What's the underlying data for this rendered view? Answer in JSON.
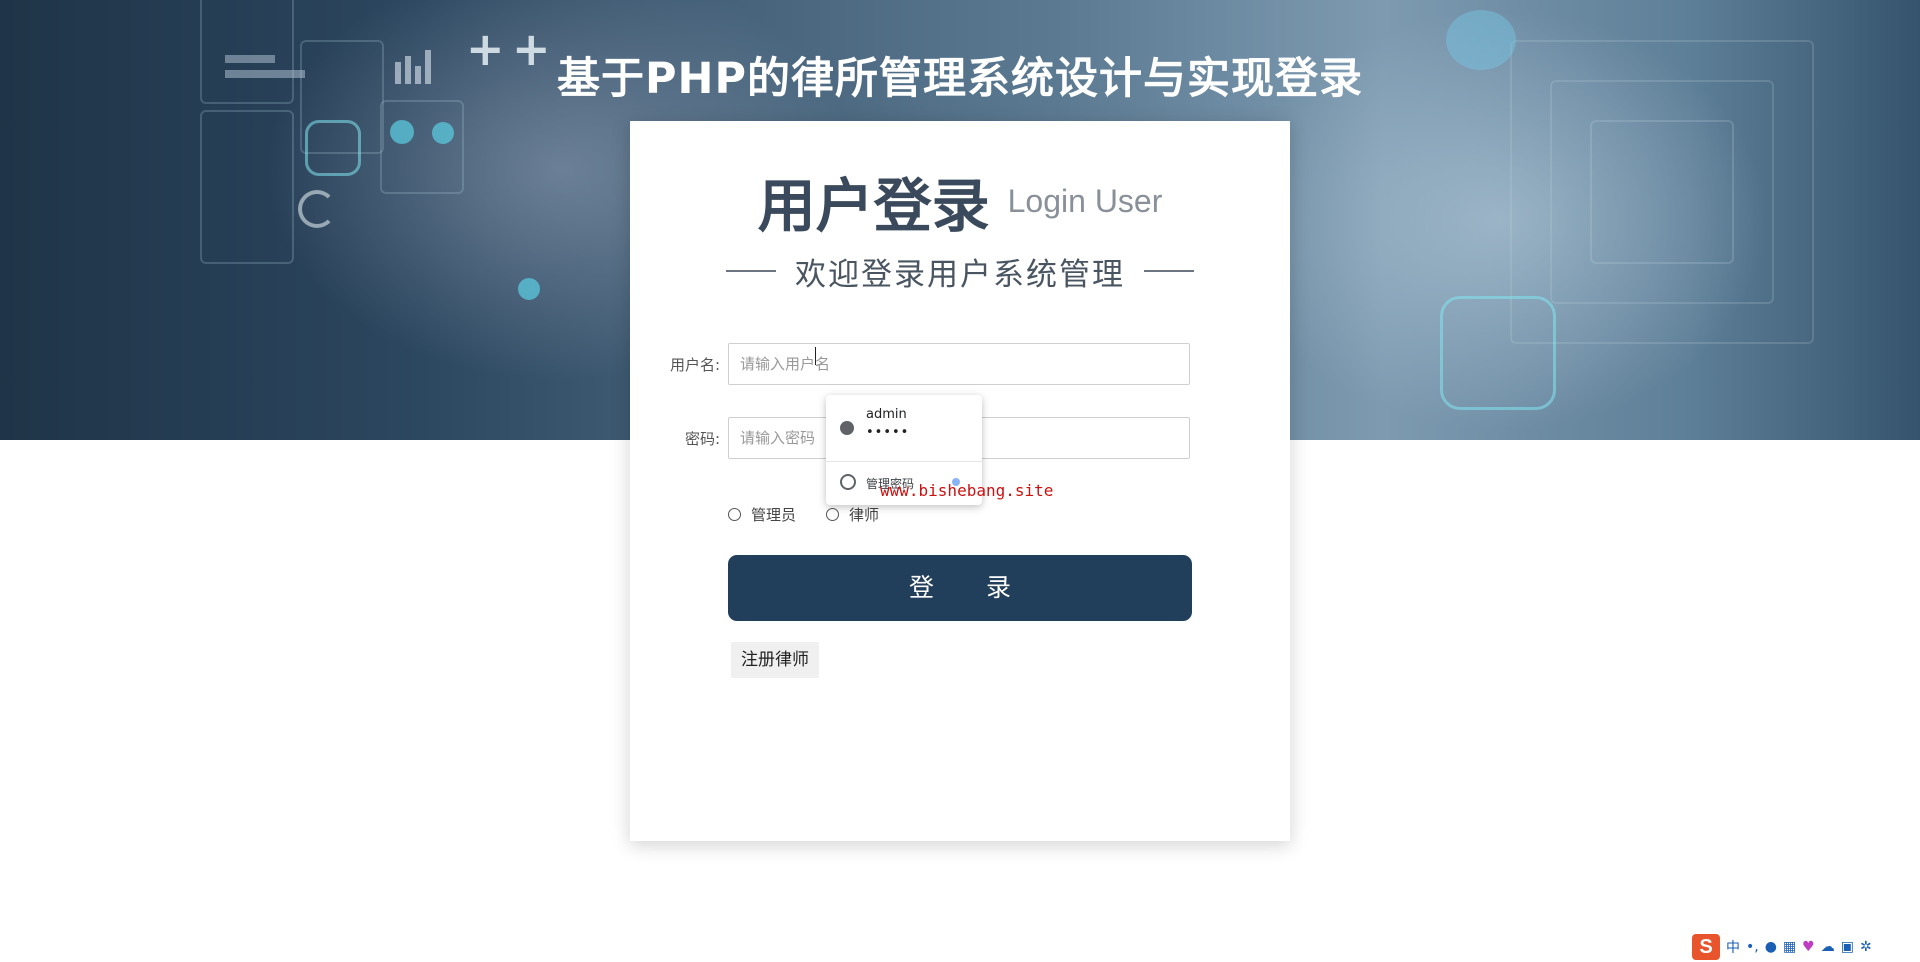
{
  "page": {
    "title": "基于PHP的律所管理系统设计与实现登录"
  },
  "login_card": {
    "title_cn": "用户登录",
    "title_en": "Login User",
    "subtitle": "欢迎登录用户系统管理",
    "username": {
      "label": "用户名:",
      "placeholder": "请输入用户名"
    },
    "password": {
      "label": "密码:",
      "placeholder": "请输入密码"
    },
    "roles": [
      {
        "label": "管理员",
        "checked": false
      },
      {
        "label": "律师",
        "checked": false
      }
    ],
    "login_button": "登 录",
    "register_link": "注册律师"
  },
  "autofill_popup": {
    "saved_username": "admin",
    "saved_password_mask": "•••••",
    "manage_label": "管理密码"
  },
  "watermark": "www.bishebang.site",
  "ime_toolbar": {
    "logo": "S",
    "mode": "中",
    "punct": "•,",
    "icons": [
      "microphone-icon",
      "keyboard-icon",
      "skin-icon",
      "cloud-icon",
      "grid-icon",
      "gear-icon"
    ]
  },
  "colors": {
    "login_button": "#213e5b",
    "title_text": "#3a4a5c",
    "watermark": "#cc1111",
    "hero_base": "#2c4760"
  }
}
